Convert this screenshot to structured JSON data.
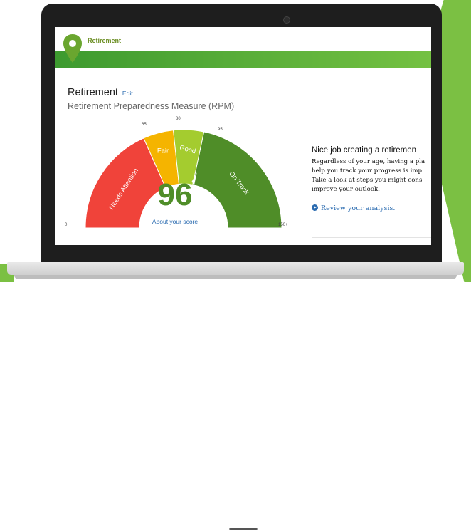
{
  "colors": {
    "brand_green": "#7bc043",
    "needs_attention": "#f0433a",
    "fair": "#f5b400",
    "good": "#a4cc2f",
    "on_track": "#4f8d28",
    "link": "#2a6bb0"
  },
  "nav": {
    "tab_label": "Retirement",
    "tab_icon": "location-pin-icon"
  },
  "page": {
    "title": "Retirement",
    "edit_label": "Edit",
    "subtitle": "Retirement Preparedness Measure (RPM)"
  },
  "gauge": {
    "score": "96",
    "score_value": 96,
    "about_label": "About your score",
    "min_label": "0",
    "max_label": "150+",
    "thresholds": [
      "65",
      "80",
      "95"
    ],
    "segments": [
      {
        "label": "Needs Attention",
        "from": 0,
        "to": 65
      },
      {
        "label": "Fair",
        "from": 65,
        "to": 80
      },
      {
        "label": "Good",
        "from": 80,
        "to": 95
      },
      {
        "label": "On Track",
        "from": 95,
        "to": 150
      }
    ]
  },
  "side": {
    "title": "Nice job creating a retiremen",
    "lines": [
      "Regardless of your age, having a pla",
      "help you track your progress is imp",
      "Take a look at steps you might cons",
      "improve your outlook."
    ],
    "review_link": "Review your analysis."
  }
}
